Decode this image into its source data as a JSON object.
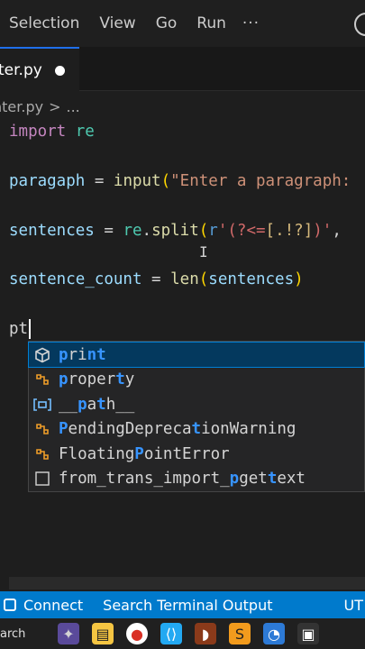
{
  "menubar": {
    "items": [
      "Selection",
      "View",
      "Go",
      "Run"
    ],
    "more": "···"
  },
  "tab": {
    "label": "ter.py",
    "modified": true
  },
  "breadcrumb": {
    "file": "nter.py",
    "sep": ">",
    "more": "..."
  },
  "editor": {
    "lines": {
      "l1": {
        "kw": "import",
        "mod": "re"
      },
      "l2": {
        "var": "paragaph",
        "eq": " = ",
        "fn": "input",
        "p1": "(",
        "str": "\"Enter a paragraph:"
      },
      "l3": {
        "var": "sentences",
        "eq": " = ",
        "mod": "re",
        "dot": ".",
        "fn": "split",
        "p1": "(",
        "rp": "r",
        "q1": "'",
        "rx1": "(?<=",
        "rxc": "[.!?]",
        "rx2": ")",
        "q2": "'",
        "tail": ","
      },
      "l4": {
        "var": "sentence_count",
        "eq": " = ",
        "fn": "len",
        "p1": "(",
        "arg": "sentences",
        "p2": ")"
      },
      "l5": {
        "typed": "pt"
      }
    },
    "ibeam": "I"
  },
  "suggestions": [
    {
      "icon": "method-cube-icon",
      "parts": [
        [
          "p",
          true
        ],
        [
          "r",
          false
        ],
        [
          "i",
          false
        ],
        [
          "nt",
          true
        ]
      ],
      "selected": true
    },
    {
      "icon": "class-icon",
      "parts": [
        [
          "p",
          true
        ],
        [
          "roper",
          false
        ],
        [
          "t",
          true
        ],
        [
          "y",
          false
        ]
      ],
      "selected": false
    },
    {
      "icon": "variable-icon",
      "parts": [
        [
          "__",
          false
        ],
        [
          "p",
          true
        ],
        [
          "a",
          false
        ],
        [
          "t",
          true
        ],
        [
          "h__",
          false
        ]
      ],
      "selected": false
    },
    {
      "icon": "class-icon",
      "parts": [
        [
          "P",
          true
        ],
        [
          "endingDepreca",
          false
        ],
        [
          "t",
          true
        ],
        [
          "ionWarning",
          false
        ]
      ],
      "selected": false
    },
    {
      "icon": "class-icon",
      "parts": [
        [
          "Floating",
          false
        ],
        [
          "P",
          true
        ],
        [
          "oint",
          false
        ],
        [
          "E",
          false
        ],
        [
          "rror",
          false
        ]
      ],
      "selected": false
    },
    {
      "icon": "text-icon",
      "parts": [
        [
          "from_trans_import_",
          false
        ],
        [
          "p",
          true
        ],
        [
          "get",
          false
        ],
        [
          "t",
          true
        ],
        [
          "ext",
          false
        ]
      ],
      "selected": false
    }
  ],
  "statusbar": {
    "connect": "Connect",
    "search": "Search Terminal Output",
    "right": "UT"
  },
  "taskbar": {
    "search": "arch"
  },
  "colors": {
    "accent": "#007acc",
    "highlight": "#3794ff"
  }
}
